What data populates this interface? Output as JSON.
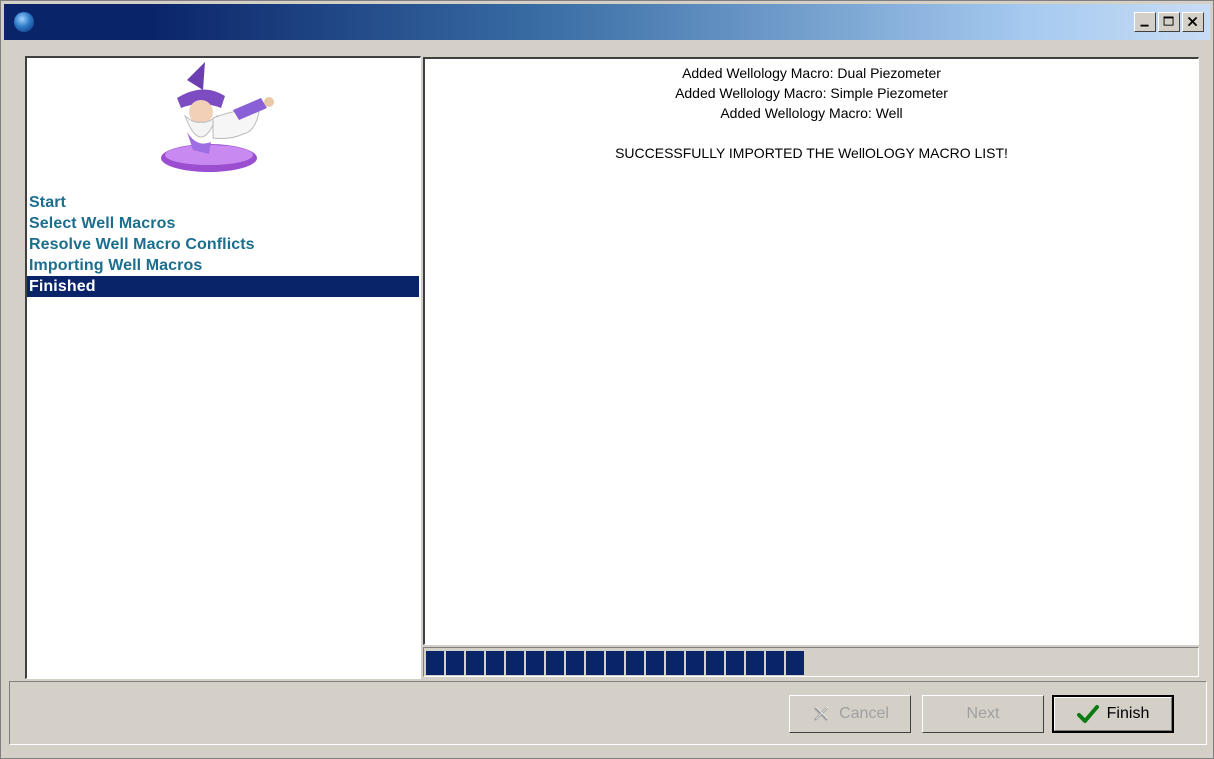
{
  "titlebar": {
    "icon": "globe-icon"
  },
  "window_controls": {
    "minimize": "minimize-icon",
    "maximize": "maximize-icon",
    "close": "close-icon"
  },
  "sidebar": {
    "image": "wizard-icon",
    "steps": [
      {
        "label": "Start"
      },
      {
        "label": "Select Well Macros"
      },
      {
        "label": "Resolve Well Macro Conflicts"
      },
      {
        "label": "Importing Well Macros"
      },
      {
        "label": "Finished"
      }
    ],
    "active_step": 4
  },
  "log": {
    "lines": [
      "Added Wellology Macro: Dual Piezometer",
      "Added Wellology Macro: Simple Piezometer",
      "Added Wellology Macro: Well",
      "",
      "SUCCESSFULLY IMPORTED THE WellOLOGY MACRO LIST!"
    ]
  },
  "progress": {
    "value_percent": 50,
    "color": "#0a246a"
  },
  "buttons": {
    "cancel": {
      "label": "Cancel",
      "icon": "x-icon"
    },
    "next": {
      "label": "Next"
    },
    "finish": {
      "label": "Finish",
      "icon": "checkmark-icon"
    }
  },
  "colors": {
    "titlebar_start": "#0a246a",
    "step_text": "#1b6e8e",
    "highlight": "#0a246a"
  }
}
